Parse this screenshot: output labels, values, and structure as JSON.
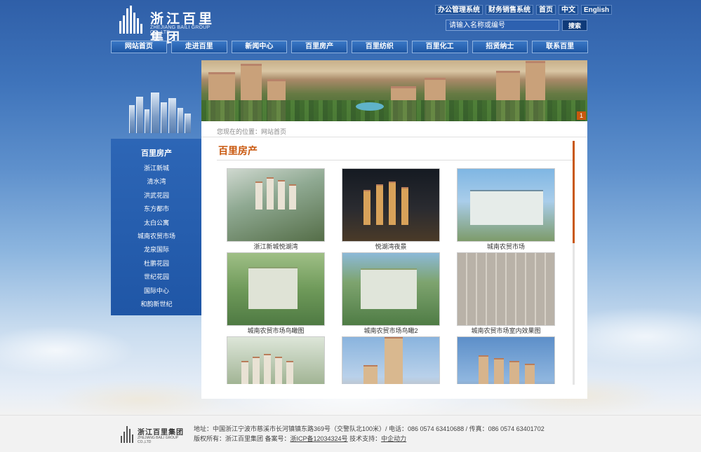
{
  "header": {
    "logo_title": "浙江百里集团",
    "logo_subtitle": "ZHEJIANG BAILI GROUP CO.,LTD",
    "top_links": [
      "办公管理系统",
      "财务销售系统",
      "首页",
      "中文",
      "English"
    ],
    "search_placeholder": "请输入名称或编号",
    "search_button": "搜索"
  },
  "nav": [
    "网站首页",
    "走进百里",
    "新闻中心",
    "百里房产",
    "百里纺织",
    "百里化工",
    "招贤纳士",
    "联系百里"
  ],
  "banner": {
    "page_indicator": "1"
  },
  "sidebar": {
    "title": "百里房产",
    "items": [
      "浙江新城",
      "清水湾",
      "洪武花园",
      "东方都市",
      "太白公寓",
      "城南农贸市场",
      "龙泉国际",
      "杜鹏花园",
      "世纪花园",
      "国际中心",
      "和韵新世纪"
    ]
  },
  "main": {
    "breadcrumb": "您现在的位置：网站首页",
    "section_title": "百里房产",
    "items": [
      {
        "caption": "浙江新城悦湖湾"
      },
      {
        "caption": "悦湖湾夜景"
      },
      {
        "caption": "城南农贸市场"
      },
      {
        "caption": "城南农贸市场鸟瞰图"
      },
      {
        "caption": "城南农贸市场鸟瞰2"
      },
      {
        "caption": "城南农贸市场室内效果图"
      },
      {
        "caption": ""
      },
      {
        "caption": ""
      },
      {
        "caption": ""
      }
    ]
  },
  "footer": {
    "logo_title": "浙江百里集团",
    "logo_subtitle": "ZHEJIANG BAILI GROUP CO.,LTD",
    "address": "地址：中国浙江宁波市慈溪市长河镇镇东路369号（交警队北100米）/ 电话：086 0574 63410688 / 传真：086 0574 63401702",
    "copyright_prefix": "版权所有：浙江百里集团  备案号：",
    "icp": "浙ICP备12034324号",
    "tech_prefix": "  技术支持：",
    "tech": "中企动力"
  },
  "colors": {
    "accent": "#c9580e",
    "nav_blue": "#1e56a3",
    "sidebar_blue": "#2d66b6"
  }
}
